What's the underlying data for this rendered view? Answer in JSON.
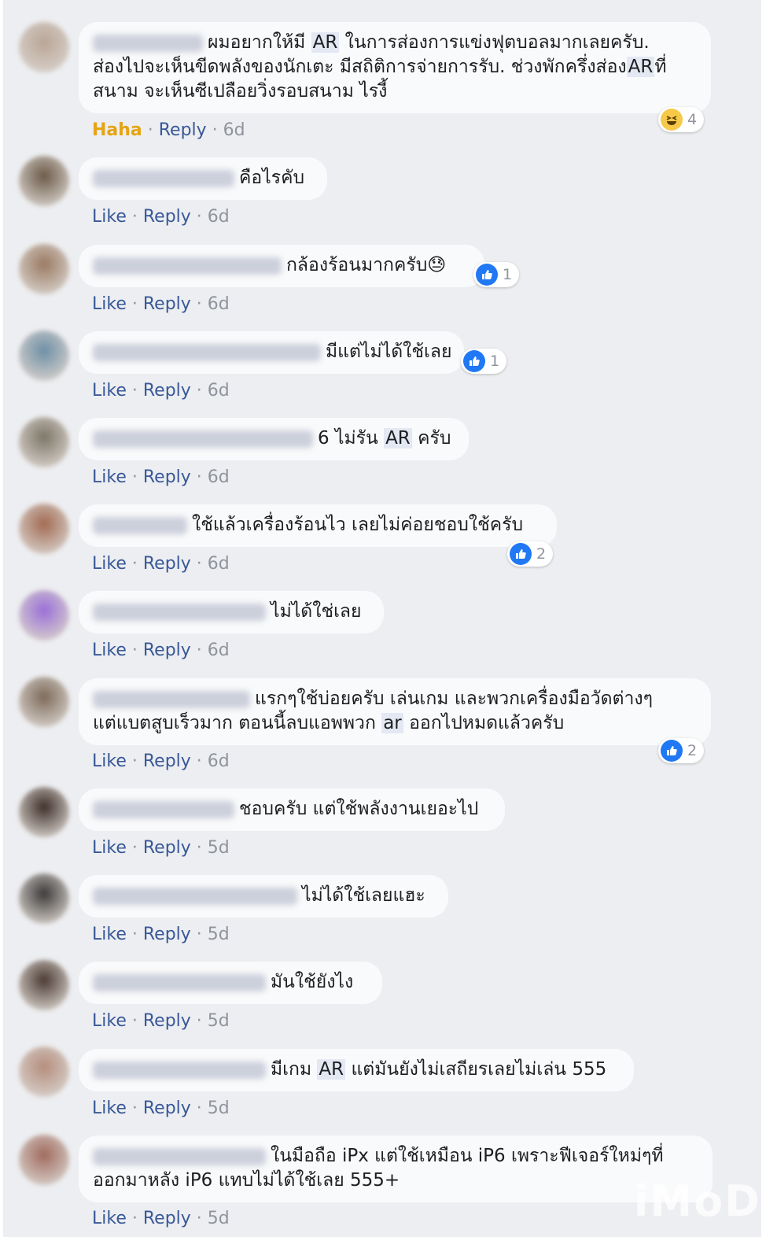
{
  "comments": [
    {
      "lines": [
        "ผมอยากให้มี AR ในการส่องการแข่งฟุตบอลมากเลยครับ.",
        "ส่องไปจะเห็นขีดพลังของนักเตะ มีสถิติการจ่ายการรับ. ช่วงพักครึ่งส่องARที่",
        "สนาม จะเห็นซีเปลือยวิ่งรอบสนาม ไรงี้"
      ],
      "reaction": "Haha",
      "reply": "Reply",
      "time": "6d",
      "reaction_icon": "haha-icon",
      "reaction_count": "4"
    },
    {
      "lines": [
        "คือไรคับ"
      ],
      "like": "Like",
      "reply": "Reply",
      "time": "6d"
    },
    {
      "lines": [
        "กล้องร้อนมากครับ😓"
      ],
      "like": "Like",
      "reply": "Reply",
      "time": "6d",
      "reaction_icon": "like-icon",
      "reaction_count": "1"
    },
    {
      "lines": [
        "มีแต่ไม่ได้ใช้เลย"
      ],
      "like": "Like",
      "reply": "Reply",
      "time": "6d",
      "reaction_icon": "like-icon",
      "reaction_count": "1"
    },
    {
      "lines": [
        "6 ไม่รัน AR ครับ"
      ],
      "like": "Like",
      "reply": "Reply",
      "time": "6d"
    },
    {
      "lines": [
        "ใช้แล้วเครื่องร้อนไว เลยไม่ค่อยชอบใช้ครับ"
      ],
      "like": "Like",
      "reply": "Reply",
      "time": "6d",
      "reaction_icon": "like-icon",
      "reaction_count": "2"
    },
    {
      "lines": [
        "ไม่ได้ใช่เลย"
      ],
      "like": "Like",
      "reply": "Reply",
      "time": "6d"
    },
    {
      "lines": [
        "แรกๆใช้บ่อยครับ เล่นเกม และพวกเครื่องมือวัดต่างๆ",
        "แต่แบตสูบเร็วมาก ตอนนี้ลบแอพพวก ar ออกไปหมดแล้วครับ"
      ],
      "like": "Like",
      "reply": "Reply",
      "time": "6d",
      "reaction_icon": "like-icon",
      "reaction_count": "2"
    },
    {
      "lines": [
        "ชอบครับ แต่ใช้พลังงานเยอะไป"
      ],
      "like": "Like",
      "reply": "Reply",
      "time": "5d"
    },
    {
      "lines": [
        "ไม่ได้ใช้เลยแฮะ"
      ],
      "like": "Like",
      "reply": "Reply",
      "time": "5d"
    },
    {
      "lines": [
        "มันใช้ยังไง"
      ],
      "like": "Like",
      "reply": "Reply",
      "time": "5d"
    },
    {
      "lines": [
        "มีเกม AR แต่มันยังไม่เสถียรเลยไม่เล่น 555"
      ],
      "like": "Like",
      "reply": "Reply",
      "time": "5d"
    },
    {
      "lines": [
        "ในมือถือ iPx แต่ใช้เหมือน iP6 เพราะฟีเจอร์ใหม่ๆที่",
        "ออกมาหลัง iP6 แทบไม่ได้ใช้เลย 555+"
      ],
      "like": "Like",
      "reply": "Reply",
      "time": "5d"
    }
  ],
  "watermark": "iMoD",
  "colors": {
    "link": "#385898",
    "meta": "#90949c",
    "haha": "#e5a414",
    "like_blue": "#2078f4"
  }
}
